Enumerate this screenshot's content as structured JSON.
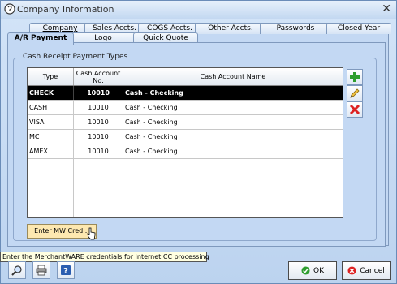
{
  "window": {
    "title": "Company Information"
  },
  "tabs_row1": [
    {
      "label": "Company"
    },
    {
      "label": "Sales Accts."
    },
    {
      "label": "COGS Accts."
    },
    {
      "label": "Other Accts."
    },
    {
      "label": "Passwords"
    },
    {
      "label": "Closed Year"
    }
  ],
  "tabs_row2": [
    {
      "label": "A/R Payment"
    },
    {
      "label": "Logo"
    },
    {
      "label": "Quick Quote"
    }
  ],
  "group": {
    "label": "Cash Receipt Payment Types"
  },
  "grid": {
    "headers": [
      "Type",
      "Cash Account No.",
      "Cash Account Name"
    ],
    "rows": [
      {
        "type": "CHECK",
        "no": "10010",
        "name": "Cash - Checking"
      },
      {
        "type": "CASH",
        "no": "10010",
        "name": "Cash - Checking"
      },
      {
        "type": "VISA",
        "no": "10010",
        "name": "Cash - Checking"
      },
      {
        "type": "MC",
        "no": "10010",
        "name": "Cash - Checking"
      },
      {
        "type": "AMEX",
        "no": "10010",
        "name": "Cash - Checking"
      }
    ]
  },
  "buttons": {
    "mw": "Enter MW Cred...",
    "ok": "OK",
    "cancel": "Cancel"
  },
  "tooltip": "Enter the MerchantWARE credentials for Internet CC processing",
  "icons": {
    "add": "plus-icon",
    "edit": "pencil-icon",
    "delete": "x-icon",
    "find": "magnifier-icon",
    "print": "printer-icon",
    "help": "question-icon"
  },
  "colors": {
    "selected_row": "#000000",
    "mw_button": "#fde8b0",
    "tooltip_bg": "#ffffe1"
  }
}
